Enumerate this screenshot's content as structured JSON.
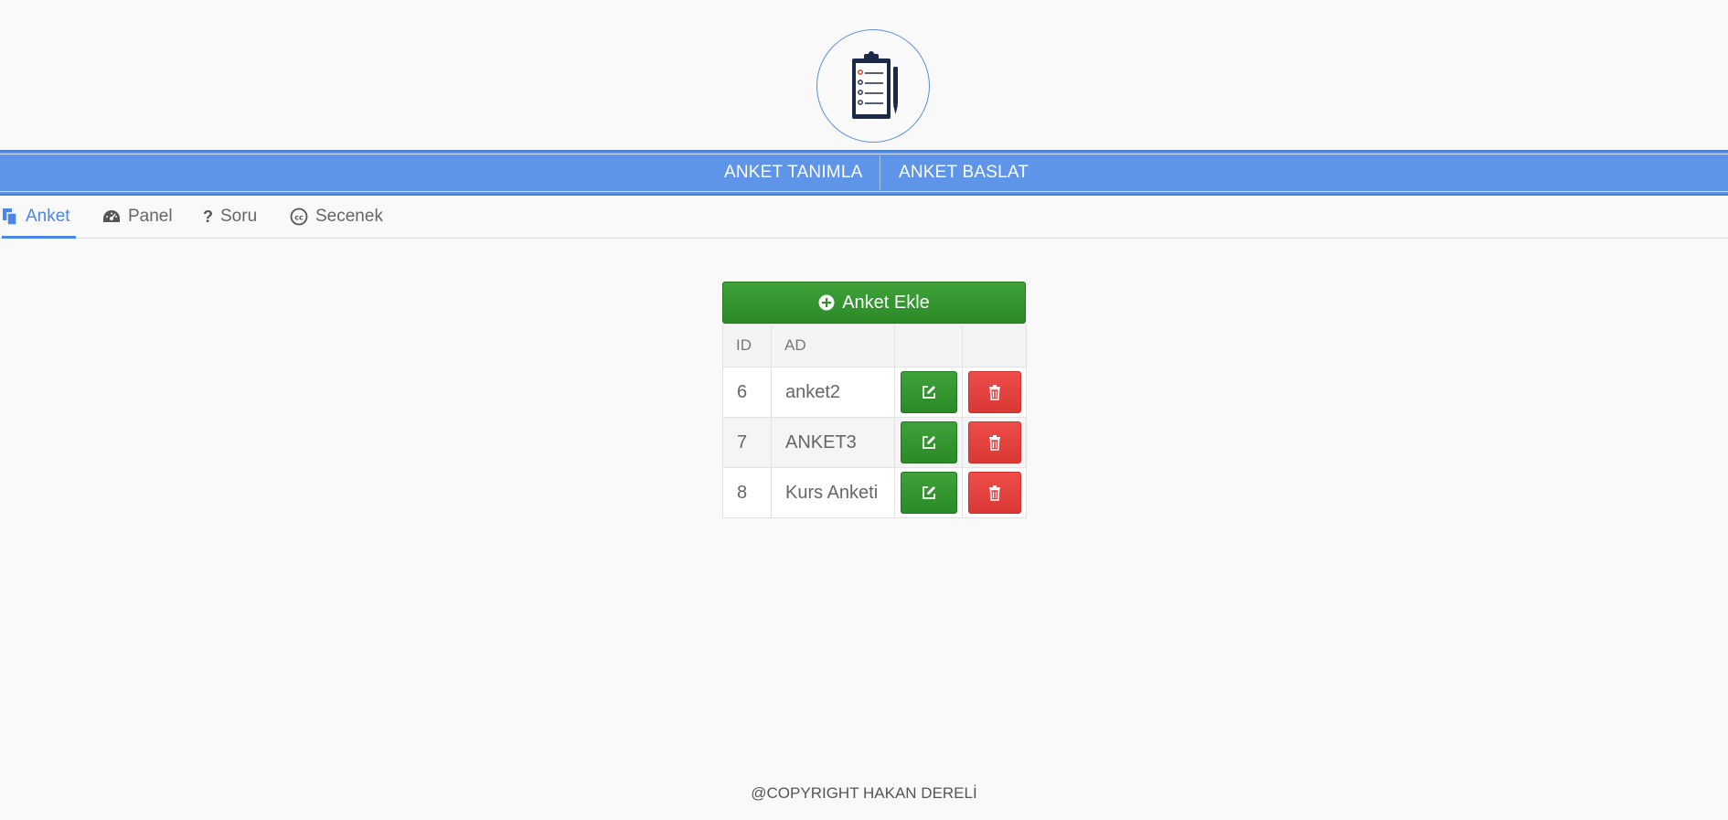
{
  "logo": {
    "icon": "clipboard-checklist-icon"
  },
  "topnav": {
    "items": [
      {
        "label": "ANKET TANIMLA"
      },
      {
        "label": "ANKET BASLAT"
      }
    ],
    "background": "#5f95e8"
  },
  "tabs": [
    {
      "label": "Anket",
      "icon": "copy-icon",
      "active": true
    },
    {
      "label": "Panel",
      "icon": "dashboard-icon",
      "active": false
    },
    {
      "label": "Soru",
      "icon": "question-icon",
      "active": false
    },
    {
      "label": "Secenek",
      "icon": "creative-commons-icon",
      "active": false
    }
  ],
  "add_button": {
    "label": "Anket Ekle",
    "icon": "plus-circle-icon",
    "color": "#2e8f2a"
  },
  "table": {
    "columns": [
      "ID",
      "AD",
      "",
      ""
    ],
    "rows": [
      {
        "id": "6",
        "ad": "anket2"
      },
      {
        "id": "7",
        "ad": "ANKET3"
      },
      {
        "id": "8",
        "ad": "Kurs Anketi"
      }
    ],
    "edit_icon": "edit-icon",
    "delete_icon": "trash-icon",
    "edit_color": "#2e8f2a",
    "delete_color": "#e04440"
  },
  "footer": {
    "text": "@COPYRIGHT HAKAN DERELİ"
  }
}
